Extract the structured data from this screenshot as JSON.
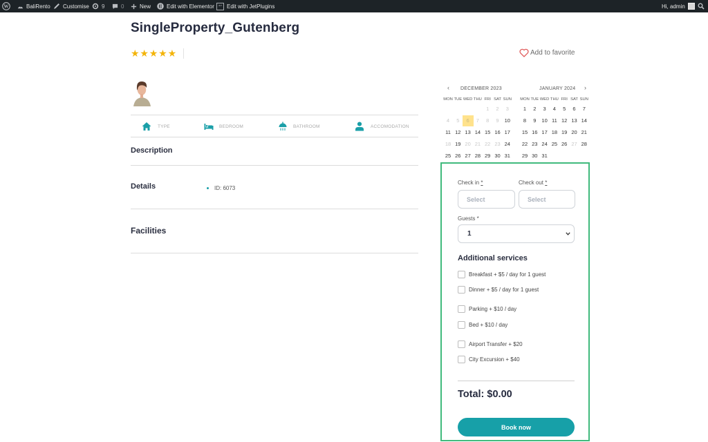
{
  "admin_bar": {
    "site_name": "BaliRento",
    "customise": "Customise",
    "updates_count": "9",
    "comments_count": "0",
    "new_label": "New",
    "elementor_label": "Edit with Elementor",
    "jetplugins_label": "Edit with JetPlugins",
    "greeting": "Hi, admin"
  },
  "property": {
    "title": "SingleProperty_Gutenberg",
    "rating": 5,
    "rating_max": 5,
    "favorite_label": "Add to favorite",
    "features": [
      {
        "icon": "home-icon",
        "label": "TYPE"
      },
      {
        "icon": "bed-icon",
        "label": "BEDROOM"
      },
      {
        "icon": "shower-icon",
        "label": "BATHROOM"
      },
      {
        "icon": "person-icon",
        "label": "ACCOMODATION"
      }
    ],
    "sections": {
      "description": "Description",
      "details": "Details",
      "details_items": [
        "ID: 6073"
      ],
      "facilities": "Facilities"
    }
  },
  "calendar": {
    "prev": "‹",
    "next": "›",
    "weekdays": [
      "MON",
      "TUE",
      "WED",
      "THU",
      "FRI",
      "SAT",
      "SUN"
    ],
    "months": [
      {
        "name": "DECEMBER 2023",
        "weeks": [
          [
            "",
            "",
            "",
            "",
            "1",
            "2",
            "3"
          ],
          [
            "4",
            "5",
            "6",
            "7",
            "8",
            "9",
            "10"
          ],
          [
            "11",
            "12",
            "13",
            "14",
            "15",
            "16",
            "17"
          ],
          [
            "18",
            "19",
            "20",
            "21",
            "22",
            "23",
            "24"
          ],
          [
            "25",
            "26",
            "27",
            "28",
            "29",
            "30",
            "31"
          ]
        ],
        "disabled": [
          "1",
          "2",
          "3",
          "4",
          "5",
          "7",
          "8",
          "9",
          "18",
          "20",
          "21",
          "22",
          "23"
        ],
        "today": "6"
      },
      {
        "name": "JANUARY 2024",
        "weeks": [
          [
            "1",
            "2",
            "3",
            "4",
            "5",
            "6",
            "7"
          ],
          [
            "8",
            "9",
            "10",
            "11",
            "12",
            "13",
            "14"
          ],
          [
            "15",
            "16",
            "17",
            "18",
            "19",
            "20",
            "21"
          ],
          [
            "22",
            "23",
            "24",
            "25",
            "26",
            "27",
            "28"
          ],
          [
            "29",
            "30",
            "31",
            "",
            "",
            "",
            ""
          ]
        ],
        "disabled": [
          "27"
        ],
        "today": ""
      }
    ]
  },
  "booking": {
    "check_in_label": "Check in",
    "check_out_label": "Check out",
    "required_mark": "*",
    "check_in_placeholder": "Select",
    "check_out_placeholder": "Select",
    "guests_label": "Guests *",
    "guests_value": "1",
    "services_title": "Additional services",
    "services": [
      {
        "label": "Breakfast + $5 / day for 1 guest",
        "checked": false
      },
      {
        "label": "Dinner + $5 / day for 1 guest",
        "checked": false
      },
      {
        "label": "Parking + $10 / day",
        "checked": false
      },
      {
        "label": "Bed + $10 / day",
        "checked": false
      },
      {
        "label": "Airport Transfer + $20",
        "checked": false
      },
      {
        "label": "City Excursion + $40",
        "checked": false
      }
    ],
    "total": "Total: $0.00",
    "book_label": "Book now"
  },
  "colors": {
    "accent": "#17a0a8",
    "star": "#f3b40a",
    "form_border": "#3fba7c",
    "today_highlight": "#ffe28c",
    "admin_bar": "#1d2327"
  }
}
